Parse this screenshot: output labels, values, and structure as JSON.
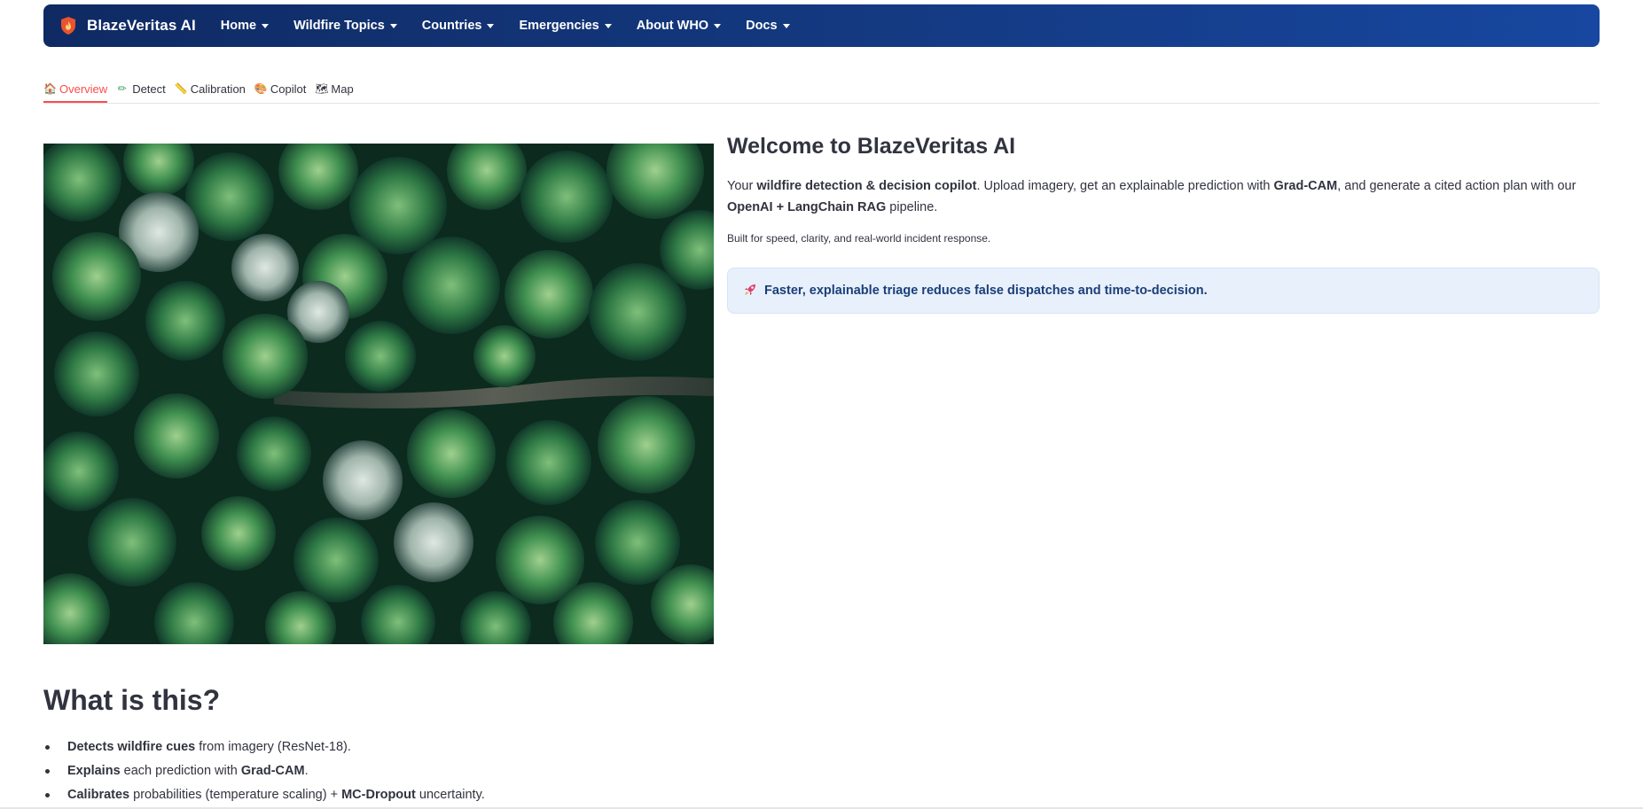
{
  "navbar": {
    "brand": "BlazeVeritas AI",
    "items": [
      {
        "label": "Home"
      },
      {
        "label": "Wildfire Topics"
      },
      {
        "label": "Countries"
      },
      {
        "label": "Emergencies"
      },
      {
        "label": "About WHO"
      },
      {
        "label": "Docs"
      }
    ]
  },
  "tabs": [
    {
      "icon": "house-icon",
      "glyph": "🏠",
      "label": "Overview",
      "active": true
    },
    {
      "icon": "pencil-icon",
      "glyph": "✏",
      "label": "Detect",
      "active": false
    },
    {
      "icon": "ruler-icon",
      "glyph": "📏",
      "label": "Calibration",
      "active": false
    },
    {
      "icon": "palette-icon",
      "glyph": "🎨",
      "label": "Copilot",
      "active": false
    },
    {
      "icon": "map-icon",
      "glyph": "🗺",
      "label": "Map",
      "active": false
    }
  ],
  "hero": {
    "image_description": "aerial forest photo with road"
  },
  "welcome": {
    "title": "Welcome to BlazeVeritas AI",
    "intro_1": "Your ",
    "intro_b1": "wildfire detection & decision copilot",
    "intro_2": ". Upload imagery, get an explainable prediction with ",
    "intro_b2": "Grad-CAM",
    "intro_3": ", and generate a cited action plan with our ",
    "intro_b3": "OpenAI + LangChain RAG",
    "intro_4": " pipeline.",
    "note": "Built for speed, clarity, and real-world incident response.",
    "callout_icon": "rocket-icon",
    "callout_text": "Faster, explainable triage reduces false dispatches and time-to-decision."
  },
  "what": {
    "title": "What is this?",
    "bullets": [
      {
        "bold": "Detects wildfire cues",
        "rest": " from imagery (ResNet-18)."
      },
      {
        "bold": "Explains",
        "rest": " each prediction with ",
        "bold2": "Grad-CAM",
        "rest2": "."
      },
      {
        "bold": "Calibrates",
        "rest": " probabilities (temperature scaling) + ",
        "bold2": "MC-Dropout",
        "rest2": " uncertainty."
      }
    ]
  },
  "colors": {
    "navbar_start": "#0f2a63",
    "navbar_end": "#1747a0",
    "tab_active": "#ff4b4b",
    "callout_bg": "#e8f0fc",
    "callout_text": "#1a3f78"
  }
}
